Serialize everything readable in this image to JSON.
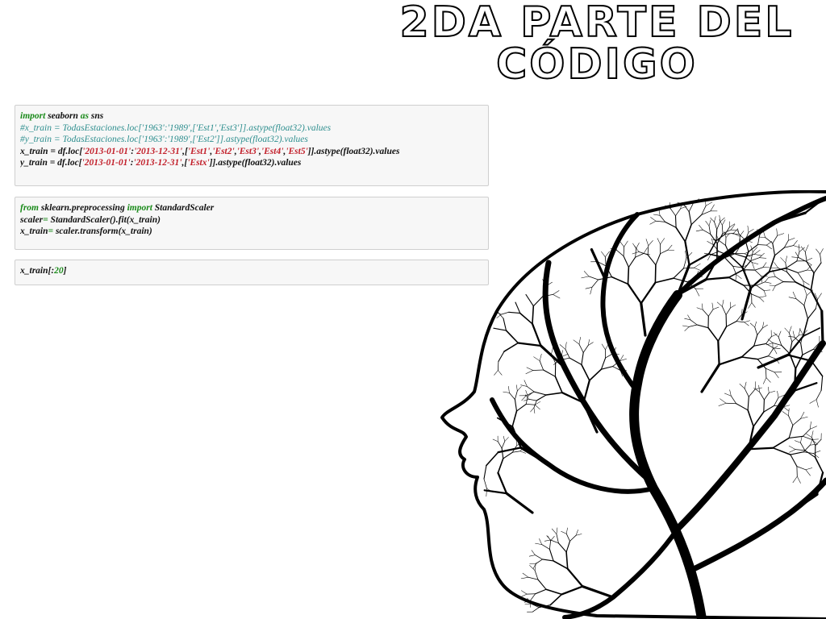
{
  "title": {
    "line1": "2DA PARTE DEL",
    "line2": "CÓDIGO"
  },
  "cells": [
    {
      "lines": [
        [
          {
            "t": "import",
            "c": "kw"
          },
          {
            "t": " seaborn ",
            "c": ""
          },
          {
            "t": "as",
            "c": "kw"
          },
          {
            "t": " sns",
            "c": ""
          }
        ],
        [
          {
            "t": "#x_train = TodasEstaciones.loc['1963':'1989',['Est1','Est3']].astype(float32).values",
            "c": "cm"
          }
        ],
        [
          {
            "t": "#y_train = TodasEstaciones.loc['1963':'1989',['Est2']].astype(float32).values",
            "c": "cm"
          }
        ],
        [
          {
            "t": "x_train = df.loc[",
            "c": ""
          },
          {
            "t": "'2013-01-01'",
            "c": "st"
          },
          {
            "t": ":",
            "c": ""
          },
          {
            "t": "'2013-12-31'",
            "c": "st"
          },
          {
            "t": ",[",
            "c": ""
          },
          {
            "t": "'Est1'",
            "c": "st"
          },
          {
            "t": ",",
            "c": ""
          },
          {
            "t": "'Est2'",
            "c": "st"
          },
          {
            "t": ",",
            "c": ""
          },
          {
            "t": "'Est3'",
            "c": "st"
          },
          {
            "t": ",",
            "c": ""
          },
          {
            "t": "'Est4'",
            "c": "st"
          },
          {
            "t": ",",
            "c": ""
          },
          {
            "t": "'Est5'",
            "c": "st"
          },
          {
            "t": "]].astype(float32).values",
            "c": ""
          }
        ],
        [
          {
            "t": "y_train = df.loc[",
            "c": ""
          },
          {
            "t": "'2013-01-01'",
            "c": "st"
          },
          {
            "t": ":",
            "c": ""
          },
          {
            "t": "'2013-12-31'",
            "c": "st"
          },
          {
            "t": ",[",
            "c": ""
          },
          {
            "t": "'Estx'",
            "c": "st"
          },
          {
            "t": "]].astype(float32).values",
            "c": ""
          }
        ]
      ]
    },
    {
      "lines": [
        [
          {
            "t": "from",
            "c": "kw"
          },
          {
            "t": " sklearn.preprocessing ",
            "c": ""
          },
          {
            "t": "import",
            "c": "kw"
          },
          {
            "t": " StandardScaler",
            "c": ""
          }
        ],
        [
          {
            "t": "scaler",
            "c": ""
          },
          {
            "t": "=",
            "c": "nm"
          },
          {
            "t": " StandardScaler().fit(x_train)",
            "c": ""
          }
        ],
        [
          {
            "t": "x_train",
            "c": ""
          },
          {
            "t": "=",
            "c": "nm"
          },
          {
            "t": " scaler.transform(x_train)",
            "c": ""
          }
        ]
      ]
    },
    {
      "lines": [
        [
          {
            "t": "x_train[:",
            "c": ""
          },
          {
            "t": "20",
            "c": "nm"
          },
          {
            "t": "]",
            "c": ""
          }
        ]
      ]
    }
  ],
  "illustration": {
    "icon": "tree-head-silhouette-icon",
    "color": "#000000"
  }
}
